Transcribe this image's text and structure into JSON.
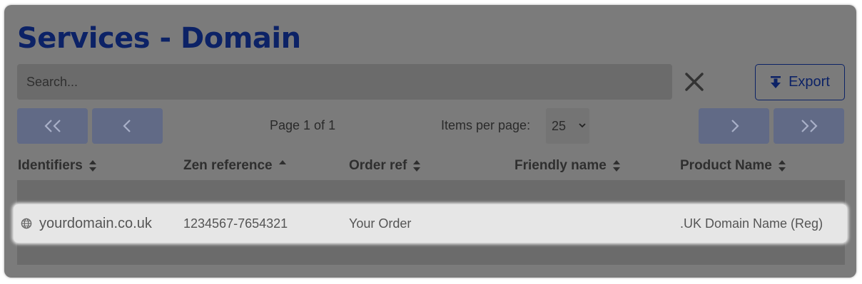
{
  "page": {
    "title": "Services - Domain"
  },
  "search": {
    "placeholder": "Search...",
    "value": ""
  },
  "toolbar": {
    "clear_icon": "close-icon",
    "export_label": "Export",
    "export_icon": "download-icon"
  },
  "pagination": {
    "first_label": "<<",
    "prev_label": "<",
    "next_label": ">",
    "last_label": ">>",
    "page_text": "Page 1 of 1",
    "items_per_page_label": "Items per page:",
    "items_per_page_value": "25"
  },
  "table": {
    "columns": [
      {
        "label": "Identifiers",
        "sort": "none"
      },
      {
        "label": "Zen reference",
        "sort": "ascending"
      },
      {
        "label": "Order ref",
        "sort": "none"
      },
      {
        "label": "Friendly name",
        "sort": "none"
      },
      {
        "label": "Product Name",
        "sort": "none"
      }
    ],
    "rows": [
      {
        "identifier": "yourdomain.co.uk",
        "identifier_icon": "globe-icon",
        "zen_reference": "1234567-7654321",
        "order_ref": "Your Order",
        "friendly_name": "",
        "product_name": ".UK Domain Name (Reg)"
      }
    ]
  },
  "colors": {
    "title": "#0c2266",
    "overlay": "#7b7b7b",
    "pager_button": "#616a86",
    "highlight_row": "#e6e6e6"
  }
}
